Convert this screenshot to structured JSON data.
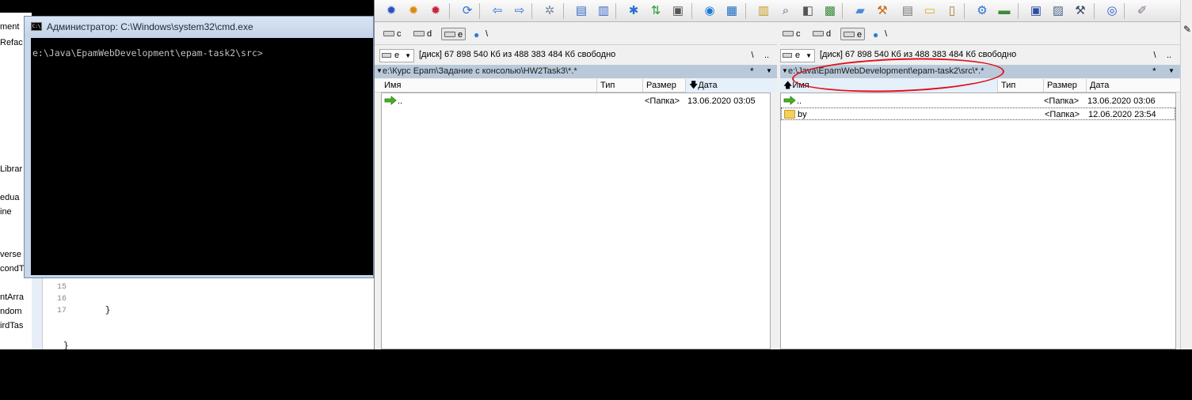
{
  "ide": {
    "sidebar_fragments": [
      "ment",
      "Refac",
      "Librar",
      "edua",
      "ine",
      "verse",
      "condT",
      "ntArra",
      "ndom",
      "irdTas"
    ],
    "line_numbers": [
      "15",
      "16",
      "17"
    ],
    "code_lines": [
      "        }",
      "}",
      ""
    ]
  },
  "cmd": {
    "icon_text": "C:\\",
    "title": "Администратор: C:\\Windows\\system32\\cmd.exe",
    "prompt": "e:\\Java\\EpamWebDevelopment\\epam-task2\\src>"
  },
  "toolbar": {
    "icons": [
      "gear-blue-icon",
      "gear-orange-icon",
      "gear-red-icon",
      "refresh-icon",
      "back-icon",
      "forward-icon",
      "network-icon",
      "pack-icon",
      "unpack-icon",
      "search-star-icon",
      "sort-icon",
      "clipboard-icon",
      "browser-icon",
      "monitor-icon",
      "copy-icon",
      "find-file-icon",
      "compare-icon",
      "sync-icon",
      "edit-icon",
      "broom-icon",
      "calculator-icon",
      "notes-icon",
      "document-icon",
      "cogs-icon",
      "drive-icon",
      "image-icon",
      "screen-icon",
      "tools-icon",
      "media-icon",
      "brush-icon"
    ]
  },
  "left_panel": {
    "drives": [
      {
        "label": "c",
        "active": false
      },
      {
        "label": "d",
        "active": false
      },
      {
        "label": "e",
        "active": true
      }
    ],
    "net_root": "\\",
    "combo": "e",
    "free_info": "[диск]  67 898 540 Кб из 488 383 484 Кб свободно",
    "btn_root": "\\",
    "btn_up": "..",
    "path": "e:\\Курс Epam\\Задание с консолью\\HW2Task3\\*.*",
    "star": "*",
    "headers": {
      "name": "Имя",
      "type": "Тип",
      "size": "Размер",
      "date": "Дата"
    },
    "sort_column": "date",
    "sort_indicator": "🡇",
    "rows": [
      {
        "icon": "up",
        "name": "..",
        "type": "",
        "size": "<Папка>",
        "date": "13.06.2020 03:05"
      }
    ]
  },
  "right_panel": {
    "drives": [
      {
        "label": "c",
        "active": false
      },
      {
        "label": "d",
        "active": false
      },
      {
        "label": "e",
        "active": true
      }
    ],
    "net_root": "\\",
    "combo": "e",
    "free_info": "[диск]  67 898 540 Кб из 488 383 484 Кб свободно",
    "btn_root": "\\",
    "btn_up": "..",
    "path": "e:\\Java\\EpamWebDevelopment\\epam-task2\\src\\*.*",
    "star": "*",
    "headers": {
      "name": "Имя",
      "type": "Тип",
      "size": "Размер",
      "date": "Дата"
    },
    "sort_column": "name",
    "sort_indicator": "🡅",
    "rows": [
      {
        "icon": "up",
        "name": "..",
        "type": "",
        "size": "<Папка>",
        "date": "13.06.2020 03:06"
      },
      {
        "icon": "folder",
        "name": "by",
        "type": "",
        "size": "<Папка>",
        "date": "12.06.2020 23:54"
      }
    ]
  },
  "annotation": {
    "color": "#e0101a"
  }
}
